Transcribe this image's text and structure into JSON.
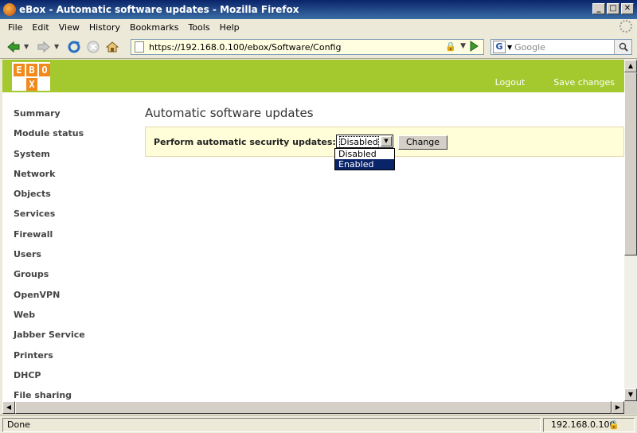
{
  "window": {
    "title": "eBox - Automatic software updates - Mozilla Firefox"
  },
  "menu": {
    "items": [
      "File",
      "Edit",
      "View",
      "History",
      "Bookmarks",
      "Tools",
      "Help"
    ]
  },
  "toolbar": {
    "back_icon": "back-arrow-icon",
    "forward_icon": "forward-arrow-icon",
    "reload_icon": "reload-icon",
    "stop_icon": "stop-icon",
    "home_icon": "home-icon",
    "go_icon": "go-arrow-icon"
  },
  "address": {
    "url": "https://192.168.0.100/ebox/Software/Config"
  },
  "search": {
    "engine_letter": "G",
    "placeholder": "Google"
  },
  "header": {
    "logo_letters": [
      "E",
      "B",
      "O",
      "X"
    ],
    "links": [
      "Logout",
      "Save changes"
    ],
    "accent_color": "#a3c92f",
    "logo_color": "#f08a1c"
  },
  "sidebar": {
    "items": [
      "Summary",
      "Module status",
      "System",
      "Network",
      "Objects",
      "Services",
      "Firewall",
      "Users",
      "Groups",
      "OpenVPN",
      "Web",
      "Jabber Service",
      "Printers",
      "DHCP",
      "File sharing"
    ]
  },
  "main": {
    "title": "Automatic software updates",
    "form": {
      "label": "Perform automatic security updates:",
      "selected": "Disabled",
      "options": [
        "Disabled",
        "Enabled"
      ],
      "highlighted_option": "Enabled",
      "submit_label": "Change"
    }
  },
  "status": {
    "left": "Done",
    "host": "192.168.0.100"
  }
}
